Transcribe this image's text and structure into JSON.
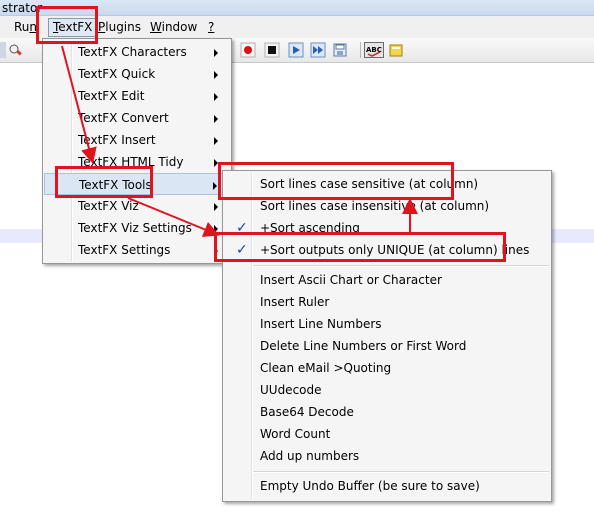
{
  "window": {
    "title_fragment": "strator"
  },
  "menubar": [
    {
      "label_pre": "Ru",
      "label_u": "n",
      "label_post": ""
    },
    {
      "label_pre": "",
      "label_u": "T",
      "label_post": "extFX"
    },
    {
      "label_pre": "",
      "label_u": "P",
      "label_post": "lugins"
    },
    {
      "label_pre": "",
      "label_u": "W",
      "label_post": "indow"
    },
    {
      "label_pre": "",
      "label_u": "?",
      "label_post": ""
    }
  ],
  "textfx_menu": {
    "items": [
      {
        "label": "TextFX Characters"
      },
      {
        "label": "TextFX Quick"
      },
      {
        "label": "TextFX Edit"
      },
      {
        "label": "TextFX Convert"
      },
      {
        "label": "TextFX Insert"
      },
      {
        "label": "TextFX HTML Tidy"
      },
      {
        "label": "TextFX Tools",
        "selected": true
      },
      {
        "label": "TextFX Viz"
      },
      {
        "label": "TextFX Viz Settings"
      },
      {
        "label": "TextFX Settings"
      }
    ]
  },
  "tools_menu": {
    "items": [
      {
        "label": "Sort lines case sensitive (at column)",
        "checked": false
      },
      {
        "label": "Sort lines case insensitive (at column)",
        "checked": false
      },
      {
        "label": "+Sort ascending",
        "checked": true
      },
      {
        "label": "+Sort outputs only UNIQUE (at column) lines",
        "checked": true
      },
      {
        "label": "Insert Ascii Chart or Character",
        "checked": false
      },
      {
        "label": "Insert Ruler",
        "checked": false
      },
      {
        "label": "Insert Line Numbers",
        "checked": false
      },
      {
        "label": "Delete Line Numbers or First Word",
        "checked": false
      },
      {
        "label": "Clean eMail >Quoting",
        "checked": false
      },
      {
        "label": "UUdecode",
        "checked": false
      },
      {
        "label": "Base64 Decode",
        "checked": false
      },
      {
        "label": "Word Count",
        "checked": false
      },
      {
        "label": "Add up numbers",
        "checked": false
      },
      {
        "label": "Empty Undo Buffer (be sure to save)",
        "checked": false
      }
    ],
    "check_glyph": "✓"
  },
  "toolbar": {
    "abc_label": "ABC"
  },
  "colors": {
    "annotation": "#e0141e",
    "check": "#0a48b8"
  }
}
